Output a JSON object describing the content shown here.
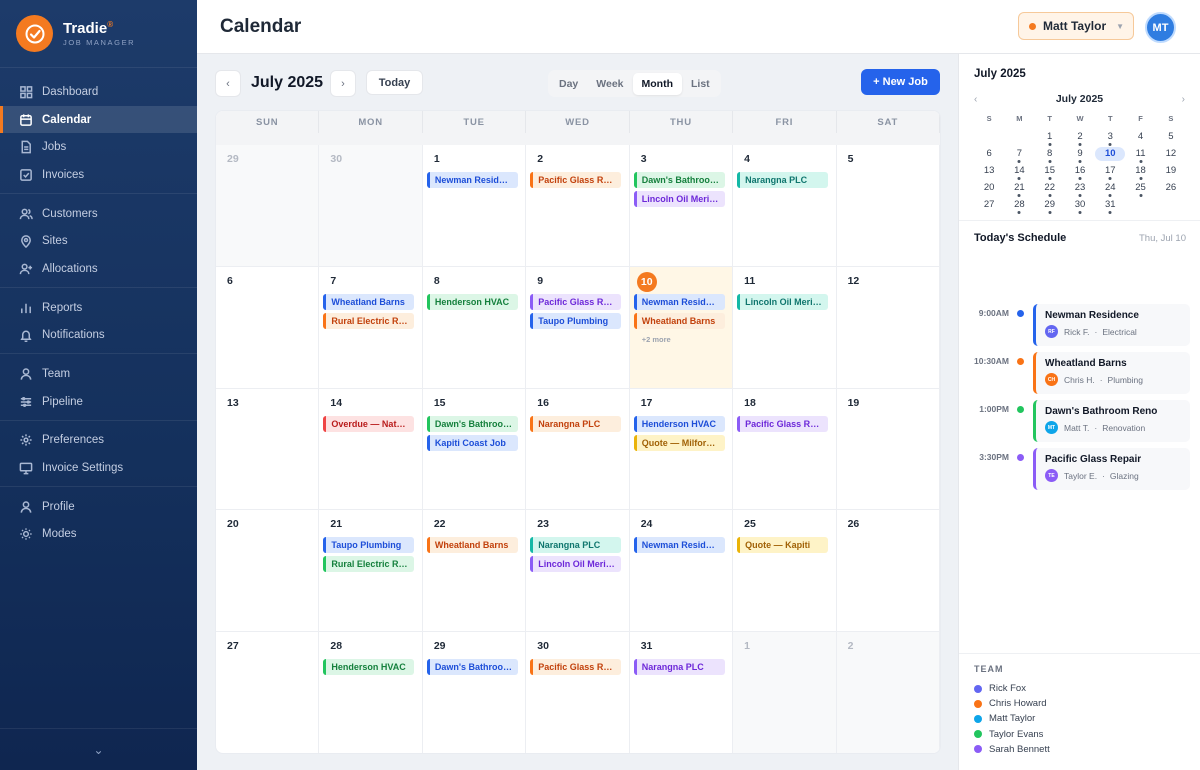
{
  "brand": {
    "name": "Tradie",
    "mark": "®",
    "subtitle": "JOB MANAGER"
  },
  "sidebar": {
    "groups": [
      [
        {
          "label": "Dashboard",
          "icon": "grid-icon"
        },
        {
          "label": "Calendar",
          "icon": "calendar-icon",
          "active": true
        },
        {
          "label": "Jobs",
          "icon": "document-icon"
        },
        {
          "label": "Invoices",
          "icon": "checkbox-icon"
        }
      ],
      [
        {
          "label": "Customers",
          "icon": "users-icon"
        },
        {
          "label": "Sites",
          "icon": "map-pin-icon"
        },
        {
          "label": "Allocations",
          "icon": "user-plus-icon"
        }
      ],
      [
        {
          "label": "Reports",
          "icon": "bar-chart-icon"
        },
        {
          "label": "Notifications",
          "icon": "bell-icon"
        }
      ],
      [
        {
          "label": "Team",
          "icon": "user-icon"
        },
        {
          "label": "Pipeline",
          "icon": "pipeline-icon"
        }
      ],
      [
        {
          "label": "Preferences",
          "icon": "gear-icon"
        },
        {
          "label": "Invoice Settings",
          "icon": "monitor-icon"
        }
      ],
      [
        {
          "label": "Profile",
          "icon": "user-icon"
        },
        {
          "label": "Modes",
          "icon": "sun-icon"
        }
      ]
    ],
    "collapse_glyph": "⌄"
  },
  "header": {
    "title": "Calendar",
    "user_name": "Matt Taylor",
    "user_initials": "MT"
  },
  "toolbar": {
    "prev": "‹",
    "next": "›",
    "month_label": "July 2025",
    "today_label": "Today",
    "views": [
      "Day",
      "Week",
      "Month",
      "List"
    ],
    "active_view": "Month",
    "new_job_label": "+ New Job"
  },
  "calendar": {
    "weekdays": [
      "SUN",
      "MON",
      "TUE",
      "WED",
      "THU",
      "FRI",
      "SAT"
    ],
    "weeks": [
      [
        {
          "d": "29",
          "muted": true,
          "events": []
        },
        {
          "d": "30",
          "muted": true,
          "events": []
        },
        {
          "d": "1",
          "events": [
            {
              "t": "Newman Residence",
              "c": "blue"
            }
          ]
        },
        {
          "d": "2",
          "events": [
            {
              "t": "Pacific Glass Repair",
              "c": "orange"
            }
          ]
        },
        {
          "d": "3",
          "events": [
            {
              "t": "Dawn's Bathroom Reno",
              "c": "green"
            },
            {
              "t": "Lincoln Oil Merino",
              "c": "purple"
            }
          ]
        },
        {
          "d": "4",
          "events": [
            {
              "t": "Narangna PLC",
              "c": "teal"
            }
          ]
        },
        {
          "d": "5",
          "events": []
        }
      ],
      [
        {
          "d": "6",
          "events": []
        },
        {
          "d": "7",
          "events": [
            {
              "t": "Wheatland Barns",
              "c": "blue"
            },
            {
              "t": "Rural Electric Repair",
              "c": "orange"
            }
          ]
        },
        {
          "d": "8",
          "events": [
            {
              "t": "Henderson HVAC",
              "c": "green"
            }
          ]
        },
        {
          "d": "9",
          "events": [
            {
              "t": "Pacific Glass Repair",
              "c": "purple"
            },
            {
              "t": "Taupo Plumbing",
              "c": "blue"
            }
          ]
        },
        {
          "d": "10",
          "today": true,
          "events": [
            {
              "t": "Newman Residence",
              "c": "blue"
            },
            {
              "t": "Wheatland Barns",
              "c": "orange"
            }
          ],
          "more": "+2 more"
        },
        {
          "d": "11",
          "events": [
            {
              "t": "Lincoln Oil Merino",
              "c": "teal"
            }
          ]
        },
        {
          "d": "12",
          "events": []
        }
      ],
      [
        {
          "d": "13",
          "events": []
        },
        {
          "d": "14",
          "events": [
            {
              "t": "Overdue — Natural Gas",
              "c": "red"
            }
          ]
        },
        {
          "d": "15",
          "events": [
            {
              "t": "Dawn's Bathroom Reno",
              "c": "green"
            },
            {
              "t": "Kapiti Coast Job",
              "c": "blue"
            }
          ]
        },
        {
          "d": "16",
          "events": [
            {
              "t": "Narangna PLC",
              "c": "orange"
            }
          ]
        },
        {
          "d": "17",
          "events": [
            {
              "t": "Henderson HVAC",
              "c": "blue"
            },
            {
              "t": "Quote — Milford Sound",
              "c": "yellow"
            }
          ]
        },
        {
          "d": "18",
          "events": [
            {
              "t": "Pacific Glass Repair",
              "c": "purple"
            }
          ]
        },
        {
          "d": "19",
          "events": []
        }
      ],
      [
        {
          "d": "20",
          "events": []
        },
        {
          "d": "21",
          "events": [
            {
              "t": "Taupo Plumbing",
              "c": "blue"
            },
            {
              "t": "Rural Electric Repair",
              "c": "green"
            }
          ]
        },
        {
          "d": "22",
          "events": [
            {
              "t": "Wheatland Barns",
              "c": "orange"
            }
          ]
        },
        {
          "d": "23",
          "events": [
            {
              "t": "Narangna PLC",
              "c": "teal"
            },
            {
              "t": "Lincoln Oil Merino",
              "c": "purple"
            }
          ]
        },
        {
          "d": "24",
          "events": [
            {
              "t": "Newman Residence",
              "c": "blue"
            }
          ]
        },
        {
          "d": "25",
          "events": [
            {
              "t": "Quote — Kapiti",
              "c": "yellow"
            }
          ]
        },
        {
          "d": "26",
          "events": []
        }
      ],
      [
        {
          "d": "27",
          "events": []
        },
        {
          "d": "28",
          "events": [
            {
              "t": "Henderson HVAC",
              "c": "green"
            }
          ]
        },
        {
          "d": "29",
          "events": [
            {
              "t": "Dawn's Bathroom Reno",
              "c": "blue"
            }
          ]
        },
        {
          "d": "30",
          "events": [
            {
              "t": "Pacific Glass Repair",
              "c": "orange"
            }
          ]
        },
        {
          "d": "31",
          "events": [
            {
              "t": "Narangna PLC",
              "c": "purple"
            }
          ]
        },
        {
          "d": "1",
          "muted": true,
          "events": []
        },
        {
          "d": "2",
          "muted": true,
          "events": []
        }
      ]
    ]
  },
  "mini_calendar": {
    "title": "July 2025",
    "label": "July 2025",
    "prev": "‹",
    "next": "›",
    "weekdays": [
      "S",
      "M",
      "T",
      "W",
      "T",
      "F",
      "S"
    ],
    "days": [
      {
        "d": ""
      },
      {
        "d": ""
      },
      {
        "d": "1",
        "dot": true
      },
      {
        "d": "2",
        "dot": true
      },
      {
        "d": "3",
        "dot": true
      },
      {
        "d": "4"
      },
      {
        "d": "5"
      },
      {
        "d": "6"
      },
      {
        "d": "7",
        "dot": true
      },
      {
        "d": "8",
        "dot": true
      },
      {
        "d": "9",
        "dot": true
      },
      {
        "d": "10",
        "today": true
      },
      {
        "d": "11",
        "dot": true
      },
      {
        "d": "12"
      },
      {
        "d": "13"
      },
      {
        "d": "14",
        "dot": true
      },
      {
        "d": "15",
        "dot": true
      },
      {
        "d": "16",
        "dot": true
      },
      {
        "d": "17",
        "dot": true
      },
      {
        "d": "18",
        "dot": true
      },
      {
        "d": "19"
      },
      {
        "d": "20"
      },
      {
        "d": "21",
        "dot": true
      },
      {
        "d": "22",
        "dot": true
      },
      {
        "d": "23",
        "dot": true
      },
      {
        "d": "24",
        "dot": true
      },
      {
        "d": "25",
        "dot": true
      },
      {
        "d": "26"
      },
      {
        "d": "27"
      },
      {
        "d": "28",
        "dot": true
      },
      {
        "d": "29",
        "dot": true
      },
      {
        "d": "30",
        "dot": true
      },
      {
        "d": "31",
        "dot": true
      },
      {
        "d": ""
      },
      {
        "d": ""
      }
    ]
  },
  "schedule": {
    "title": "Today's Schedule",
    "date": "Thu, Jul 10",
    "items": [
      {
        "time": "9:00AM",
        "title": "Newman Residence",
        "initials": "RF",
        "person": "Rick F.",
        "trade": "Electrical",
        "color": "#2563eb",
        "avatar": "#6366f1"
      },
      {
        "time": "10:30AM",
        "title": "Wheatland Barns",
        "initials": "CH",
        "person": "Chris H.",
        "trade": "Plumbing",
        "color": "#f97316",
        "avatar": "#f97316"
      },
      {
        "time": "1:00PM",
        "title": "Dawn's Bathroom Reno",
        "initials": "MT",
        "person": "Matt T.",
        "trade": "Renovation",
        "color": "#22c55e",
        "avatar": "#0ea5e9"
      },
      {
        "time": "3:30PM",
        "title": "Pacific Glass Repair",
        "initials": "TE",
        "person": "Taylor E.",
        "trade": "Glazing",
        "color": "#8b5cf6",
        "avatar": "#8b5cf6"
      }
    ],
    "separator": "·"
  },
  "team": {
    "title": "TEAM",
    "members": [
      {
        "name": "Rick Fox",
        "color": "#6366f1"
      },
      {
        "name": "Chris Howard",
        "color": "#f97316"
      },
      {
        "name": "Matt Taylor",
        "color": "#0ea5e9"
      },
      {
        "name": "Taylor Evans",
        "color": "#22c55e"
      },
      {
        "name": "Sarah Bennett",
        "color": "#8b5cf6"
      }
    ]
  }
}
